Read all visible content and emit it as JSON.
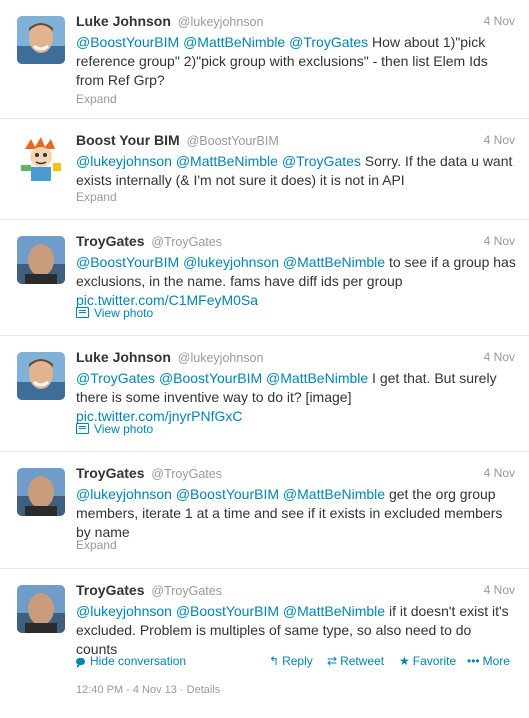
{
  "tweets": [
    {
      "fullname": "Luke Johnson",
      "username": "@lukeyjohnson",
      "time": "4 Nov",
      "parts": [
        {
          "t": "mention",
          "v": "@BoostYourBIM"
        },
        {
          "t": "text",
          "v": " "
        },
        {
          "t": "mention",
          "v": "@MattBeNimble"
        },
        {
          "t": "text",
          "v": " "
        },
        {
          "t": "mention",
          "v": "@TroyGates"
        },
        {
          "t": "text",
          "v": " How about 1)\"pick reference group\" 2)\"pick group with exclusions\" - then list Elem Ids from Ref Grp?"
        }
      ],
      "action": "Expand"
    },
    {
      "fullname": "Boost Your BIM",
      "username": "@BoostYourBIM",
      "time": "4 Nov",
      "parts": [
        {
          "t": "mention",
          "v": "@lukeyjohnson"
        },
        {
          "t": "text",
          "v": " "
        },
        {
          "t": "mention",
          "v": "@MattBeNimble"
        },
        {
          "t": "text",
          "v": " "
        },
        {
          "t": "mention",
          "v": "@TroyGates"
        },
        {
          "t": "text",
          "v": " Sorry. If the data u want exists internally (& I'm not sure it does) it is not in API"
        }
      ],
      "action": "Expand"
    },
    {
      "fullname": "TroyGates",
      "username": "@TroyGates",
      "time": "4 Nov",
      "parts": [
        {
          "t": "mention",
          "v": "@BoostYourBIM"
        },
        {
          "t": "text",
          "v": " "
        },
        {
          "t": "mention",
          "v": "@lukeyjohnson"
        },
        {
          "t": "text",
          "v": " "
        },
        {
          "t": "mention",
          "v": "@MattBeNimble"
        },
        {
          "t": "text",
          "v": " to see if a group has exclusions, in the name. fams have diff ids per group"
        }
      ],
      "link": "pic.twitter.com/C1MFeyM0Sa",
      "action": "View photo"
    },
    {
      "fullname": "Luke Johnson",
      "username": "@lukeyjohnson",
      "time": "4 Nov",
      "parts": [
        {
          "t": "mention",
          "v": "@TroyGates"
        },
        {
          "t": "text",
          "v": " "
        },
        {
          "t": "mention",
          "v": "@BoostYourBIM"
        },
        {
          "t": "text",
          "v": " "
        },
        {
          "t": "mention",
          "v": "@MattBeNimble"
        },
        {
          "t": "text",
          "v": " I get that.  But surely there is some inventive way to do it? [image]"
        }
      ],
      "link": "pic.twitter.com/jnyrPNfGxC",
      "action": "View photo"
    },
    {
      "fullname": "TroyGates",
      "username": "@TroyGates",
      "time": "4 Nov",
      "parts": [
        {
          "t": "mention",
          "v": "@lukeyjohnson"
        },
        {
          "t": "text",
          "v": " "
        },
        {
          "t": "mention",
          "v": "@BoostYourBIM"
        },
        {
          "t": "text",
          "v": " "
        },
        {
          "t": "mention",
          "v": "@MattBeNimble"
        },
        {
          "t": "text",
          "v": " get the org group members, iterate 1 at a time and see if it exists in excluded members by name"
        }
      ],
      "action": "Expand"
    },
    {
      "fullname": "TroyGates",
      "username": "@TroyGates",
      "time": "4 Nov",
      "parts": [
        {
          "t": "mention",
          "v": "@lukeyjohnson"
        },
        {
          "t": "text",
          "v": " "
        },
        {
          "t": "mention",
          "v": "@BoostYourBIM"
        },
        {
          "t": "text",
          "v": " "
        },
        {
          "t": "mention",
          "v": "@MattBeNimble"
        },
        {
          "t": "text",
          "v": " if it doesn't exist it's excluded. Problem is multiples of same type, so also need to do counts"
        }
      ],
      "action": "Hide conversation"
    }
  ],
  "expanded_actions": {
    "reply": "Reply",
    "retweet": "Retweet",
    "favorite": "Favorite",
    "more": "More"
  },
  "footer_meta": "12:40 PM - 4 Nov 13 · Details",
  "colors": {
    "link": "#0084b4",
    "meta": "#999999",
    "text": "#333333"
  }
}
